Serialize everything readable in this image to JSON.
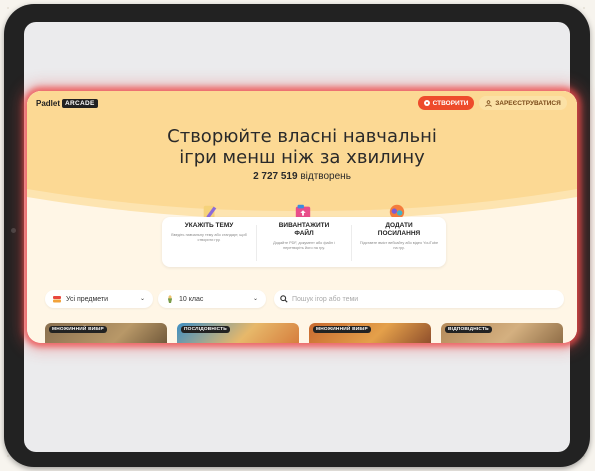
{
  "header": {
    "logo_text": "Padlet",
    "logo_badge": "ARCADE",
    "create_label": "СТВОРИТИ",
    "register_label": "ЗАРЕЄСТРУВАТИСЯ"
  },
  "hero": {
    "title_line1": "Створюйте власні навчальні",
    "title_line2": "ігри менш ніж за хвилину",
    "plays_count": "2 727 519",
    "plays_suffix": "відтворень"
  },
  "steps": [
    {
      "title": "УКАЖІТЬ ТЕМУ",
      "desc": "Введіть навчальну тему або стандарт, щоб створити гру."
    },
    {
      "title_line1": "ВИВАНТАЖИТИ",
      "title_line2": "ФАЙЛ",
      "desc": "Додайте PDF, документ або файл і перетворіть його на гру."
    },
    {
      "title_line1": "ДОДАТИ",
      "title_line2": "ПОСИЛАННЯ",
      "desc": "Підставте вміст вебсайту або відео YouTube на гру."
    }
  ],
  "filters": {
    "subject": "Усі предмети",
    "grade": "10 клас",
    "search_placeholder": "Пошук ігор або теми"
  },
  "cards": [
    {
      "label": "МНОЖИННИЙ ВИБІР"
    },
    {
      "label": "ПОСЛІДОВНІСТЬ"
    },
    {
      "label": "МНОЖИННИЙ ВИБІР"
    },
    {
      "label": "ВІДПОВІДНІСТЬ"
    }
  ],
  "colors": {
    "accent_red": "#ee4b2b",
    "hero_yellow": "#fcd994",
    "register_bg": "#fbe1a6"
  }
}
